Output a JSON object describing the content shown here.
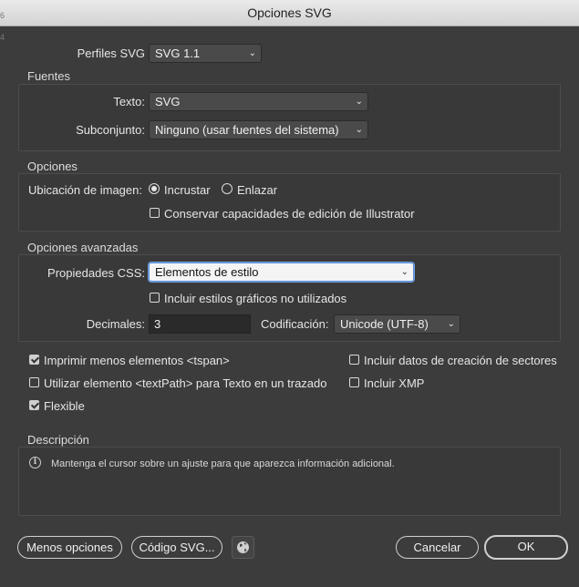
{
  "window": {
    "title": "Opciones SVG"
  },
  "edge_glyphs": [
    "6",
    "4"
  ],
  "profile": {
    "label": "Perfiles SVG",
    "value": "SVG 1.1"
  },
  "fonts": {
    "heading": "Fuentes",
    "type_label": "Texto:",
    "type_value": "SVG",
    "subset_label": "Subconjunto:",
    "subset_value": "Ninguno (usar fuentes del sistema)"
  },
  "options": {
    "heading": "Opciones",
    "image_location_label": "Ubicación de imagen:",
    "embed_label": "Incrustar",
    "embed_selected": true,
    "link_label": "Enlazar",
    "link_selected": false,
    "preserve_label": "Conservar capacidades de edición de Illustrator",
    "preserve_checked": false
  },
  "advanced": {
    "heading": "Opciones avanzadas",
    "css_label": "Propiedades CSS:",
    "css_value": "Elementos de estilo",
    "unused_styles_label": "Incluir estilos gráficos no utilizados",
    "unused_styles_checked": false,
    "decimals_label": "Decimales:",
    "decimals_value": "3",
    "encoding_label": "Codificación:",
    "encoding_value": "Unicode (UTF-8)",
    "checks": {
      "tspan": {
        "label": "Imprimir menos elementos <tspan>",
        "checked": true
      },
      "textpath": {
        "label": "Utilizar elemento <textPath> para Texto en un trazado",
        "checked": false
      },
      "responsive": {
        "label": "Flexible",
        "checked": true
      },
      "slicing": {
        "label": "Incluir datos de creación de sectores",
        "checked": false
      },
      "xmp": {
        "label": "Incluir XMP",
        "checked": false
      }
    }
  },
  "description": {
    "heading": "Descripción",
    "text": "Mantenga el cursor sobre un ajuste para que aparezca información adicional."
  },
  "footer": {
    "less_options": "Menos opciones",
    "svg_code": "Código SVG...",
    "cancel": "Cancelar",
    "ok": "OK"
  },
  "icons": {
    "dropdown": "chevron-down-icon",
    "info": "info-icon",
    "globe": "globe-icon"
  },
  "colors": {
    "dialog_bg": "#3c3c3c",
    "focus_ring": "#5b8fd6"
  }
}
